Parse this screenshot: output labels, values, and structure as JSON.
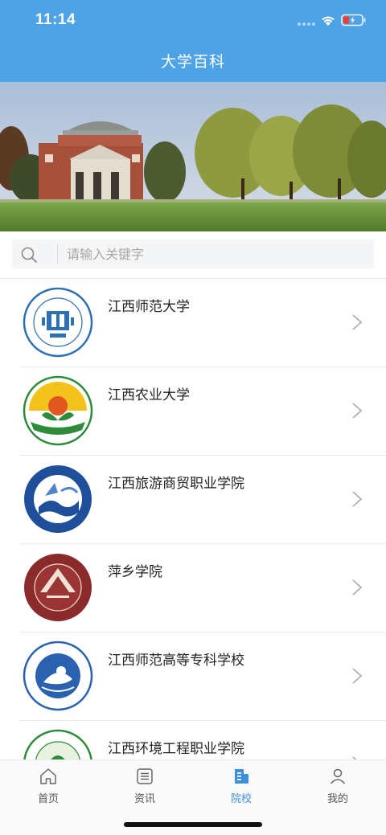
{
  "status_bar": {
    "time": "11:14"
  },
  "header": {
    "title": "大学百科"
  },
  "search": {
    "placeholder": "请输入关键字",
    "value": ""
  },
  "universities": [
    {
      "name": "江西师范大学",
      "logo": "jxnu-logo"
    },
    {
      "name": "江西农业大学",
      "logo": "jxau-logo"
    },
    {
      "name": "江西旅游商贸职业学院",
      "logo": "jxtcvc-logo"
    },
    {
      "name": "萍乡学院",
      "logo": "pxu-logo"
    },
    {
      "name": "江西师范高等专科学校",
      "logo": "jxtc-logo"
    },
    {
      "name": "江西环境工程职业学院",
      "logo": "jxeevc-logo"
    }
  ],
  "tabbar": {
    "tabs": [
      {
        "label": "首页",
        "icon": "home-icon",
        "active": false
      },
      {
        "label": "资讯",
        "icon": "news-icon",
        "active": false
      },
      {
        "label": "院校",
        "icon": "school-icon",
        "active": true
      },
      {
        "label": "我的",
        "icon": "profile-icon",
        "active": false
      }
    ]
  },
  "colors": {
    "primary": "#4ea3e6",
    "active_tab": "#3d8fe0"
  }
}
